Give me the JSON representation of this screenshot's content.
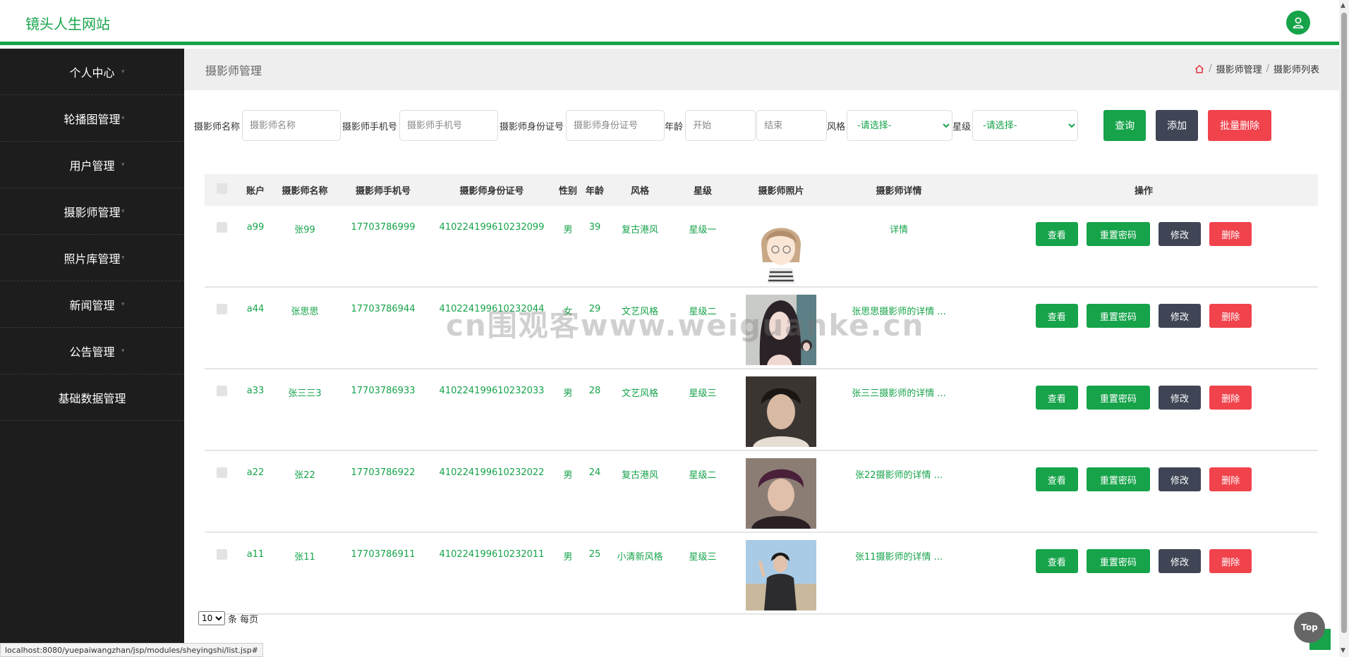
{
  "header": {
    "brand": "镜头人生网站"
  },
  "sidebar": {
    "items": [
      {
        "label": "个人中心"
      },
      {
        "label": "轮播图管理"
      },
      {
        "label": "用户管理"
      },
      {
        "label": "摄影师管理"
      },
      {
        "label": "照片库管理"
      },
      {
        "label": "新闻管理"
      },
      {
        "label": "公告管理"
      },
      {
        "label": "基础数据管理"
      }
    ]
  },
  "crumbbar": {
    "title": "摄影师管理",
    "breadcrumb": [
      "摄影师管理",
      "摄影师列表"
    ]
  },
  "search": {
    "name_label": "摄影师名称",
    "name_placeholder": "摄影师名称",
    "phone_label": "摄影师手机号",
    "phone_placeholder": "摄影师手机号",
    "idcard_label": "摄影师身份证号",
    "idcard_placeholder": "摄影师身份证号",
    "age_label": "年龄",
    "age_start_placeholder": "开始",
    "age_end_placeholder": "结束",
    "style_label": "风格",
    "style_selected": "-请选择-",
    "level_label": "星级",
    "level_selected": "-请选择-",
    "query_btn": "查询",
    "add_btn": "添加",
    "batch_delete_btn": "批量删除"
  },
  "table": {
    "headers": [
      "",
      "账户",
      "摄影师名称",
      "摄影师手机号",
      "摄影师身份证号",
      "性别",
      "年龄",
      "风格",
      "星级",
      "摄影师照片",
      "摄影师详情",
      "操作"
    ],
    "actions": {
      "view": "查看",
      "reset": "重置密码",
      "edit": "修改",
      "delete": "删除"
    },
    "rows": [
      {
        "account": "a99",
        "name": "张99",
        "phone": "17703786999",
        "idcard": "410224199610232099",
        "gender": "男",
        "age": "39",
        "style": "复古港风",
        "level": "星级一",
        "detail": "详情"
      },
      {
        "account": "a44",
        "name": "张思思",
        "phone": "17703786944",
        "idcard": "410224199610232044",
        "gender": "女",
        "age": "29",
        "style": "文艺风格",
        "level": "星级二",
        "detail": "张思思摄影师的详情 ..."
      },
      {
        "account": "a33",
        "name": "张三三3",
        "phone": "17703786933",
        "idcard": "410224199610232033",
        "gender": "男",
        "age": "28",
        "style": "文艺风格",
        "level": "星级三",
        "detail": "张三三摄影师的详情 ..."
      },
      {
        "account": "a22",
        "name": "张22",
        "phone": "17703786922",
        "idcard": "410224199610232022",
        "gender": "男",
        "age": "24",
        "style": "复古港风",
        "level": "星级二",
        "detail": "张22摄影师的详情 ..."
      },
      {
        "account": "a11",
        "name": "张11",
        "phone": "17703786911",
        "idcard": "410224199610232011",
        "gender": "男",
        "age": "25",
        "style": "小清新风格",
        "level": "星级三",
        "detail": "张11摄影师的详情 ..."
      }
    ]
  },
  "pager": {
    "size": "10",
    "suffix": "条 每页"
  },
  "watermark": "cn围观客www.weiguanke.cn",
  "statusbar": "localhost:8080/yuepaiwangzhan/jsp/modules/sheyingshi/list.jsp#",
  "top_button": "Top",
  "colors": {
    "accent": "#16a34a",
    "edit": "#3f4555",
    "danger": "#f0434c",
    "sidebar": "#1d1d1d"
  },
  "icons": {
    "user": "user-icon",
    "home": "home-icon"
  }
}
